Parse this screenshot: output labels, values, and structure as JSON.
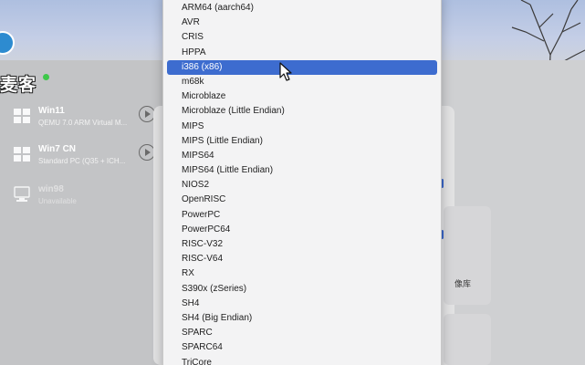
{
  "overlay": {
    "brand_text": "麦客"
  },
  "vms": [
    {
      "name": "Win11",
      "desc": "QEMU 7.0 ARM Virtual M...",
      "icon": "windows-icon",
      "state": "normal"
    },
    {
      "name": "Win7 CN",
      "desc": "Standard PC (Q35 + ICH...",
      "icon": "windows-icon",
      "state": "normal"
    },
    {
      "name": "win98",
      "desc": "Unavailable",
      "icon": "computer-icon",
      "state": "dim"
    }
  ],
  "background_dialog": {
    "side_label": "像库"
  },
  "architecture_menu": {
    "selected": "i386 (x86)",
    "items": [
      "ARM64 (aarch64)",
      "AVR",
      "CRIS",
      "HPPA",
      "i386 (x86)",
      "m68k",
      "Microblaze",
      "Microblaze (Little Endian)",
      "MIPS",
      "MIPS (Little Endian)",
      "MIPS64",
      "MIPS64 (Little Endian)",
      "NIOS2",
      "OpenRISC",
      "PowerPC",
      "PowerPC64",
      "RISC-V32",
      "RISC-V64",
      "RX",
      "S390x (zSeries)",
      "SH4",
      "SH4 (Big Endian)",
      "SPARC",
      "SPARC64",
      "TriCore"
    ]
  },
  "colors": {
    "selection": "#3d6ccf",
    "status_dot": "#3ec84a"
  }
}
